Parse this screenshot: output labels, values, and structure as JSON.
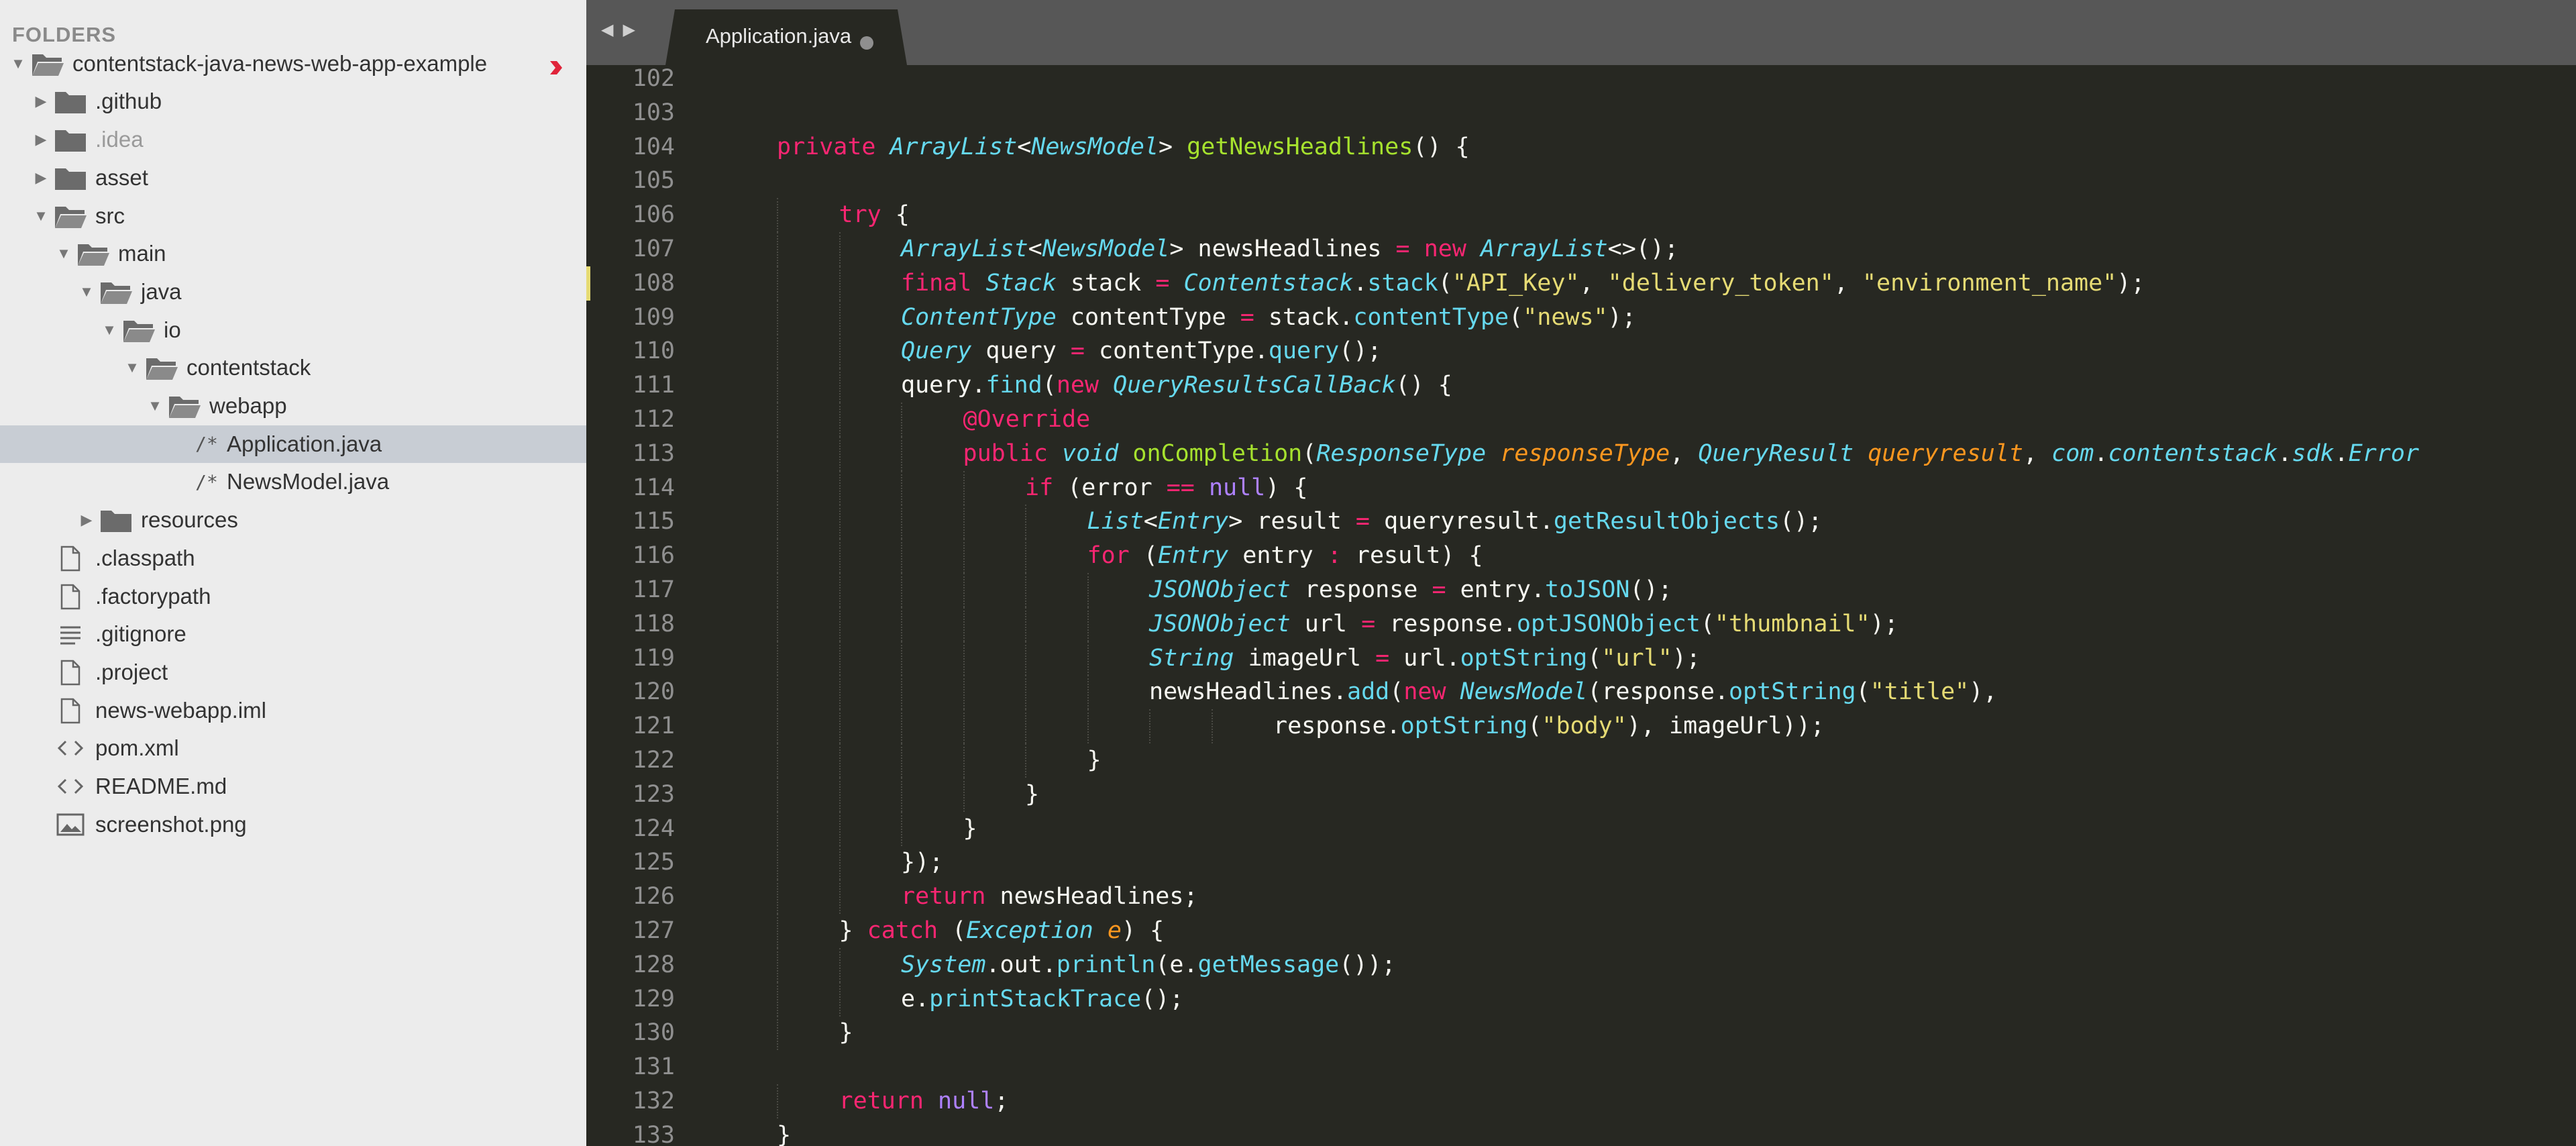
{
  "sidebar": {
    "header": "FOLDERS",
    "items": [
      {
        "label": "contentstack-java-news-web-app-example",
        "kind": "folder-open",
        "depth": 0,
        "expanded": true,
        "dirty": true
      },
      {
        "label": ".github",
        "kind": "folder",
        "depth": 1,
        "expanded": false
      },
      {
        "label": ".idea",
        "kind": "folder",
        "depth": 1,
        "expanded": false,
        "dim": true
      },
      {
        "label": "asset",
        "kind": "folder",
        "depth": 1,
        "expanded": false
      },
      {
        "label": "src",
        "kind": "folder-open",
        "depth": 1,
        "expanded": true
      },
      {
        "label": "main",
        "kind": "folder-open",
        "depth": 2,
        "expanded": true
      },
      {
        "label": "java",
        "kind": "folder-open",
        "depth": 3,
        "expanded": true
      },
      {
        "label": "io",
        "kind": "folder-open",
        "depth": 4,
        "expanded": true
      },
      {
        "label": "contentstack",
        "kind": "folder-open",
        "depth": 5,
        "expanded": true
      },
      {
        "label": "webapp",
        "kind": "folder-open",
        "depth": 6,
        "expanded": true
      },
      {
        "label": "Application.java",
        "kind": "java",
        "depth": 7,
        "prefix": "/*",
        "selected": true
      },
      {
        "label": "NewsModel.java",
        "kind": "java",
        "depth": 7,
        "prefix": "/*"
      },
      {
        "label": "resources",
        "kind": "folder",
        "depth": 3,
        "expanded": false
      },
      {
        "label": ".classpath",
        "kind": "file",
        "depth": 1
      },
      {
        "label": ".factorypath",
        "kind": "file",
        "depth": 1
      },
      {
        "label": ".gitignore",
        "kind": "lines",
        "depth": 1
      },
      {
        "label": ".project",
        "kind": "file",
        "depth": 1
      },
      {
        "label": "news-webapp.iml",
        "kind": "file",
        "depth": 1
      },
      {
        "label": "pom.xml",
        "kind": "code",
        "depth": 1
      },
      {
        "label": "README.md",
        "kind": "code",
        "depth": 1
      },
      {
        "label": "screenshot.png",
        "kind": "image",
        "depth": 1
      }
    ]
  },
  "tabs": {
    "nav_back": "◀",
    "nav_forward": "▶",
    "active_tab": "Application.java"
  },
  "colors": {
    "keyword": "#f92672",
    "type": "#66d9ef",
    "function": "#a6e22e",
    "string": "#e6db74",
    "parameter": "#fd971f",
    "constant": "#ae81ff",
    "plain": "#f8f8f2",
    "editor_bg": "#272822",
    "sidebar_bg": "#ececec"
  },
  "editor": {
    "lines": [
      {
        "n": "102",
        "indent": 0,
        "tokens": []
      },
      {
        "n": "103",
        "indent": 0,
        "tokens": []
      },
      {
        "n": "104",
        "indent": 1,
        "tokens": [
          [
            "kw",
            "private "
          ],
          [
            "type",
            "ArrayList"
          ],
          [
            "plain",
            "<"
          ],
          [
            "type",
            "NewsModel"
          ],
          [
            "plain",
            "> "
          ],
          [
            "fn",
            "getNewsHeadlines"
          ],
          [
            "plain",
            "() {"
          ]
        ]
      },
      {
        "n": "105",
        "indent": 0,
        "tokens": []
      },
      {
        "n": "106",
        "indent": 2,
        "tokens": [
          [
            "kw",
            "try"
          ],
          [
            "plain",
            " {"
          ]
        ]
      },
      {
        "n": "107",
        "indent": 3,
        "tokens": [
          [
            "type",
            "ArrayList"
          ],
          [
            "plain",
            "<"
          ],
          [
            "type",
            "NewsModel"
          ],
          [
            "plain",
            "> newsHeadlines "
          ],
          [
            "kw",
            "="
          ],
          [
            "plain",
            " "
          ],
          [
            "kw",
            "new "
          ],
          [
            "type",
            "ArrayList"
          ],
          [
            "plain",
            "<>();"
          ]
        ]
      },
      {
        "n": "108",
        "indent": 3,
        "mark": true,
        "tokens": [
          [
            "kw",
            "final "
          ],
          [
            "type",
            "Stack"
          ],
          [
            "plain",
            " stack "
          ],
          [
            "kw",
            "="
          ],
          [
            "plain",
            " "
          ],
          [
            "type",
            "Contentstack"
          ],
          [
            "plain",
            "."
          ],
          [
            "call",
            "stack"
          ],
          [
            "plain",
            "("
          ],
          [
            "str",
            "\"API_Key\""
          ],
          [
            "plain",
            ", "
          ],
          [
            "str",
            "\"delivery_token\""
          ],
          [
            "plain",
            ", "
          ],
          [
            "str",
            "\"environment_name\""
          ],
          [
            "plain",
            ");"
          ]
        ]
      },
      {
        "n": "109",
        "indent": 3,
        "tokens": [
          [
            "type",
            "ContentType"
          ],
          [
            "plain",
            " contentType "
          ],
          [
            "kw",
            "="
          ],
          [
            "plain",
            " stack."
          ],
          [
            "call",
            "contentType"
          ],
          [
            "plain",
            "("
          ],
          [
            "str",
            "\"news\""
          ],
          [
            "plain",
            ");"
          ]
        ]
      },
      {
        "n": "110",
        "indent": 3,
        "tokens": [
          [
            "type",
            "Query"
          ],
          [
            "plain",
            " query "
          ],
          [
            "kw",
            "="
          ],
          [
            "plain",
            " contentType."
          ],
          [
            "call",
            "query"
          ],
          [
            "plain",
            "();"
          ]
        ]
      },
      {
        "n": "111",
        "indent": 3,
        "tokens": [
          [
            "plain",
            "query."
          ],
          [
            "call",
            "find"
          ],
          [
            "plain",
            "("
          ],
          [
            "kw",
            "new "
          ],
          [
            "type",
            "QueryResultsCallBack"
          ],
          [
            "plain",
            "() {"
          ]
        ]
      },
      {
        "n": "112",
        "indent": 4,
        "tokens": [
          [
            "kw",
            "@Override"
          ]
        ]
      },
      {
        "n": "113",
        "indent": 4,
        "tokens": [
          [
            "kw",
            "public "
          ],
          [
            "type",
            "void"
          ],
          [
            "plain",
            " "
          ],
          [
            "fn",
            "onCompletion"
          ],
          [
            "plain",
            "("
          ],
          [
            "type",
            "ResponseType"
          ],
          [
            "plain",
            " "
          ],
          [
            "param",
            "responseType"
          ],
          [
            "plain",
            ", "
          ],
          [
            "type",
            "QueryResult"
          ],
          [
            "plain",
            " "
          ],
          [
            "param",
            "queryresult"
          ],
          [
            "plain",
            ", "
          ],
          [
            "type",
            "com"
          ],
          [
            "plain",
            "."
          ],
          [
            "type",
            "contentstack"
          ],
          [
            "plain",
            "."
          ],
          [
            "type",
            "sdk"
          ],
          [
            "plain",
            "."
          ],
          [
            "type",
            "Error"
          ]
        ]
      },
      {
        "n": "114",
        "indent": 5,
        "tokens": [
          [
            "kw",
            "if "
          ],
          [
            "plain",
            "(error "
          ],
          [
            "kw",
            "=="
          ],
          [
            "plain",
            " "
          ],
          [
            "const",
            "null"
          ],
          [
            "plain",
            ") {"
          ]
        ]
      },
      {
        "n": "115",
        "indent": 6,
        "tokens": [
          [
            "type",
            "List"
          ],
          [
            "plain",
            "<"
          ],
          [
            "type",
            "Entry"
          ],
          [
            "plain",
            "> result "
          ],
          [
            "kw",
            "="
          ],
          [
            "plain",
            " queryresult."
          ],
          [
            "call",
            "getResultObjects"
          ],
          [
            "plain",
            "();"
          ]
        ]
      },
      {
        "n": "116",
        "indent": 6,
        "tokens": [
          [
            "kw",
            "for "
          ],
          [
            "plain",
            "("
          ],
          [
            "type",
            "Entry"
          ],
          [
            "plain",
            " entry "
          ],
          [
            "kw",
            ":"
          ],
          [
            "plain",
            " result) {"
          ]
        ]
      },
      {
        "n": "117",
        "indent": 7,
        "tokens": [
          [
            "type",
            "JSONObject"
          ],
          [
            "plain",
            " response "
          ],
          [
            "kw",
            "="
          ],
          [
            "plain",
            " entry."
          ],
          [
            "call",
            "toJSON"
          ],
          [
            "plain",
            "();"
          ]
        ]
      },
      {
        "n": "118",
        "indent": 7,
        "tokens": [
          [
            "type",
            "JSONObject"
          ],
          [
            "plain",
            " url "
          ],
          [
            "kw",
            "="
          ],
          [
            "plain",
            " response."
          ],
          [
            "call",
            "optJSONObject"
          ],
          [
            "plain",
            "("
          ],
          [
            "str",
            "\"thumbnail\""
          ],
          [
            "plain",
            ");"
          ]
        ]
      },
      {
        "n": "119",
        "indent": 7,
        "tokens": [
          [
            "type",
            "String"
          ],
          [
            "plain",
            " imageUrl "
          ],
          [
            "kw",
            "="
          ],
          [
            "plain",
            " url."
          ],
          [
            "call",
            "optString"
          ],
          [
            "plain",
            "("
          ],
          [
            "str",
            "\"url\""
          ],
          [
            "plain",
            ");"
          ]
        ]
      },
      {
        "n": "120",
        "indent": 7,
        "tokens": [
          [
            "plain",
            "newsHeadlines."
          ],
          [
            "call",
            "add"
          ],
          [
            "plain",
            "("
          ],
          [
            "kw",
            "new "
          ],
          [
            "type",
            "NewsModel"
          ],
          [
            "plain",
            "(response."
          ],
          [
            "call",
            "optString"
          ],
          [
            "plain",
            "("
          ],
          [
            "str",
            "\"title\""
          ],
          [
            "plain",
            "),"
          ]
        ]
      },
      {
        "n": "121",
        "indent": 9,
        "tokens": [
          [
            "plain",
            "response."
          ],
          [
            "call",
            "optString"
          ],
          [
            "plain",
            "("
          ],
          [
            "str",
            "\"body\""
          ],
          [
            "plain",
            "), imageUrl));"
          ]
        ]
      },
      {
        "n": "122",
        "indent": 6,
        "tokens": [
          [
            "plain",
            "}"
          ]
        ]
      },
      {
        "n": "123",
        "indent": 5,
        "tokens": [
          [
            "plain",
            "}"
          ]
        ]
      },
      {
        "n": "124",
        "indent": 4,
        "tokens": [
          [
            "plain",
            "}"
          ]
        ]
      },
      {
        "n": "125",
        "indent": 3,
        "tokens": [
          [
            "plain",
            "});"
          ]
        ]
      },
      {
        "n": "126",
        "indent": 3,
        "tokens": [
          [
            "kw",
            "return "
          ],
          [
            "plain",
            "newsHeadlines;"
          ]
        ]
      },
      {
        "n": "127",
        "indent": 2,
        "tokens": [
          [
            "plain",
            "} "
          ],
          [
            "kw",
            "catch "
          ],
          [
            "plain",
            "("
          ],
          [
            "type",
            "Exception"
          ],
          [
            "plain",
            " "
          ],
          [
            "param",
            "e"
          ],
          [
            "plain",
            ") {"
          ]
        ]
      },
      {
        "n": "128",
        "indent": 3,
        "tokens": [
          [
            "type",
            "System"
          ],
          [
            "plain",
            ".out."
          ],
          [
            "call",
            "println"
          ],
          [
            "plain",
            "(e."
          ],
          [
            "call",
            "getMessage"
          ],
          [
            "plain",
            "());"
          ]
        ]
      },
      {
        "n": "129",
        "indent": 3,
        "tokens": [
          [
            "plain",
            "e."
          ],
          [
            "call",
            "printStackTrace"
          ],
          [
            "plain",
            "();"
          ]
        ]
      },
      {
        "n": "130",
        "indent": 2,
        "tokens": [
          [
            "plain",
            "}"
          ]
        ]
      },
      {
        "n": "131",
        "indent": 0,
        "tokens": []
      },
      {
        "n": "132",
        "indent": 2,
        "tokens": [
          [
            "kw",
            "return "
          ],
          [
            "const",
            "null"
          ],
          [
            "plain",
            ";"
          ]
        ]
      },
      {
        "n": "133",
        "indent": 1,
        "tokens": [
          [
            "plain",
            "}"
          ]
        ]
      }
    ]
  }
}
